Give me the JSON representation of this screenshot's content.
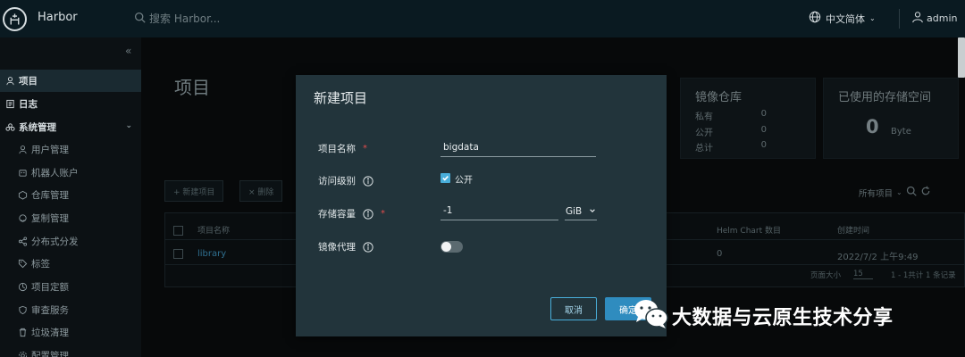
{
  "header": {
    "brand": "Harbor",
    "search_placeholder": "搜索 Harbor...",
    "language": "中文简体",
    "username": "admin"
  },
  "sidebar": {
    "collapse_glyph": "«",
    "items": [
      {
        "label": "项目",
        "icon": "people-icon",
        "level": "top",
        "active": true
      },
      {
        "label": "日志",
        "icon": "log-icon",
        "level": "top"
      },
      {
        "label": "系统管理",
        "icon": "admin-icon",
        "level": "top",
        "expanded": true
      },
      {
        "label": "用户管理",
        "icon": "user-icon",
        "level": "sub"
      },
      {
        "label": "机器人账户",
        "icon": "robot-icon",
        "level": "sub"
      },
      {
        "label": "仓库管理",
        "icon": "registry-icon",
        "level": "sub"
      },
      {
        "label": "复制管理",
        "icon": "replication-icon",
        "level": "sub"
      },
      {
        "label": "分布式分发",
        "icon": "share-icon",
        "level": "sub"
      },
      {
        "label": "标签",
        "icon": "tag-icon",
        "level": "sub"
      },
      {
        "label": "项目定额",
        "icon": "quota-icon",
        "level": "sub"
      },
      {
        "label": "审查服务",
        "icon": "shield-icon",
        "level": "sub"
      },
      {
        "label": "垃圾清理",
        "icon": "trash-icon",
        "level": "sub"
      },
      {
        "label": "配置管理",
        "icon": "settings-icon",
        "level": "sub"
      }
    ]
  },
  "main": {
    "title": "项目",
    "repo_card": {
      "title": "镜像仓库",
      "rows": [
        {
          "label": "私有",
          "value": "0"
        },
        {
          "label": "公开",
          "value": "0"
        },
        {
          "label": "总计",
          "value": "0"
        }
      ]
    },
    "storage_card": {
      "title": "已使用的存储空间",
      "value": "0",
      "unit": "Byte"
    },
    "new_project_btn": "+ 新建项目",
    "delete_btn": "× 删除",
    "filter": "所有项目",
    "table": {
      "headers": [
        "项目名称",
        "Helm Chart 数目",
        "创建时间"
      ],
      "rows": [
        {
          "name": "library",
          "helm": "0",
          "created": "2022/7/2 上午9:49"
        }
      ],
      "page_size_label": "页面大小",
      "page_size": "15",
      "summary": "1 - 1共计 1 条记录"
    }
  },
  "modal": {
    "title": "新建项目",
    "fields": {
      "name_label": "项目名称",
      "name_value": "bigdata",
      "access_label": "访问级别",
      "public_label": "公开",
      "public_checked": true,
      "storage_label": "存储容量",
      "storage_value": "-1",
      "storage_unit": "GiB",
      "proxy_label": "镜像代理",
      "proxy_enabled": false
    },
    "required_mark": "*",
    "cancel": "取消",
    "confirm": "确定"
  },
  "watermark": {
    "text": "大数据与云原生技术分享"
  },
  "colors": {
    "accent": "#49aeda",
    "primary_button": "#2f8cbf",
    "modal_bg": "#22343b",
    "header_bg": "#0a1a21"
  }
}
